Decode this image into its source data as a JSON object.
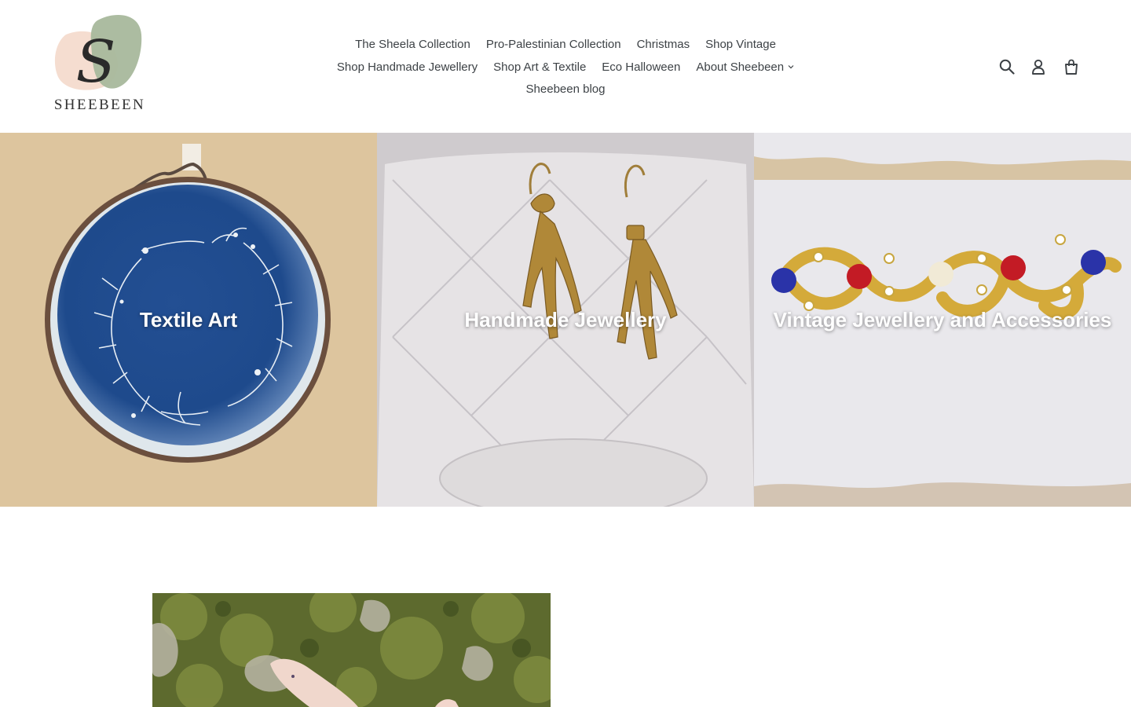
{
  "brand": {
    "logo_letter": "S",
    "logo_text": "SHEEBEEN",
    "colors": {
      "pink_blob": "#f5ddd0",
      "green_blob": "#a8b89c",
      "text": "#3d4246"
    }
  },
  "nav": {
    "items": [
      {
        "label": "The Sheela Collection"
      },
      {
        "label": "Pro-Palestinian Collection"
      },
      {
        "label": "Christmas"
      },
      {
        "label": "Shop Vintage"
      },
      {
        "label": "Shop Handmade Jewellery"
      },
      {
        "label": "Shop Art & Textile"
      },
      {
        "label": "Eco Halloween"
      },
      {
        "label": "About Sheebeen",
        "has_dropdown": true,
        "dropdown_icon": "chevron-down-icon"
      },
      {
        "label": "Sheebeen blog"
      }
    ]
  },
  "header_icons": [
    "search-icon",
    "account-icon",
    "cart-icon"
  ],
  "collections": [
    {
      "title": "Textile Art",
      "image": "blue cyanotype embroidery hoop with botanical wreath"
    },
    {
      "title": "Handmade Jewellery",
      "image": "gold bird-claw drop earrings on cut glass bowl"
    },
    {
      "title": "Vintage Jewellery and Accessories",
      "image": "gold brooch with red, blue and clear stones"
    }
  ],
  "featured_image": "hand holding jewellery against green moss"
}
